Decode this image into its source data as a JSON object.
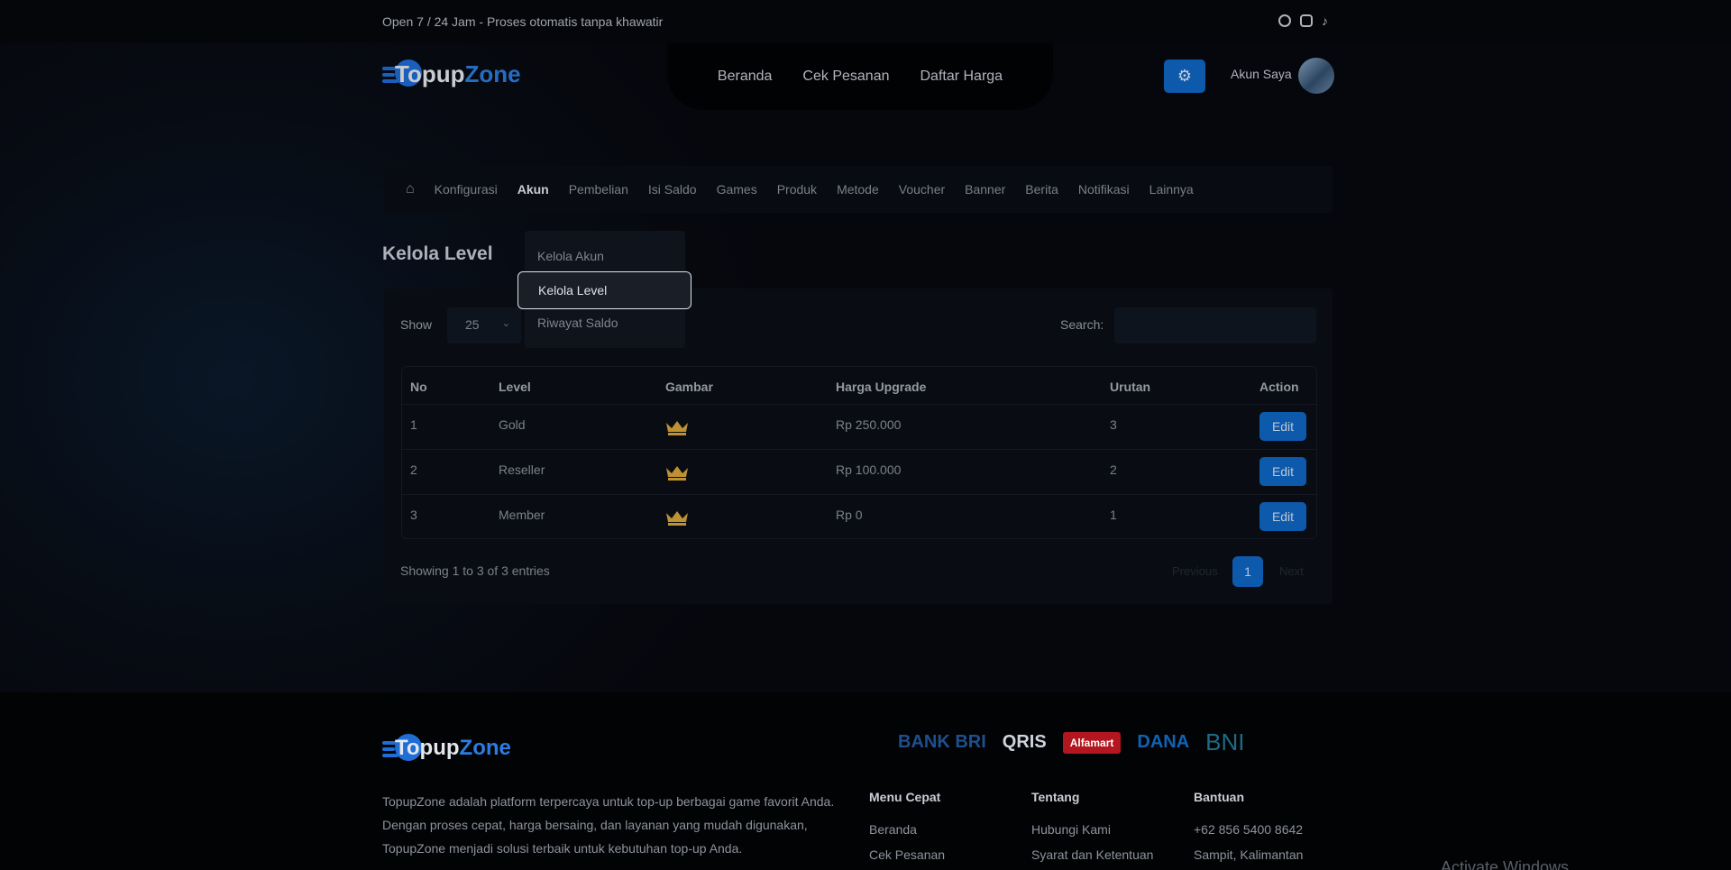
{
  "topbar": {
    "tagline": "Open 7 / 24 Jam - Proses otomatis tanpa khawatir"
  },
  "brand": {
    "part1": "Topup",
    "part2": "Zone"
  },
  "nav": [
    "Beranda",
    "Cek Pesanan",
    "Daftar Harga"
  ],
  "account": {
    "label": "Akun Saya"
  },
  "admin_nav": [
    "Konfigurasi",
    "Akun",
    "Pembelian",
    "Isi Saldo",
    "Games",
    "Produk",
    "Metode",
    "Voucher",
    "Banner",
    "Berita",
    "Notifikasi",
    "Lainnya"
  ],
  "page": {
    "title": "Kelola Level"
  },
  "dropdown": [
    "Kelola Akun",
    "Kelola Level",
    "Riwayat Saldo"
  ],
  "controls": {
    "show_label": "Show",
    "show_value": "25",
    "search_label": "Search:"
  },
  "table": {
    "headers": [
      "No",
      "Level",
      "Gambar",
      "Harga Upgrade",
      "Urutan",
      "Action"
    ],
    "rows": [
      {
        "no": "1",
        "level": "Gold",
        "price": "Rp 250.000",
        "order": "3",
        "action": "Edit"
      },
      {
        "no": "2",
        "level": "Reseller",
        "price": "Rp 100.000",
        "order": "2",
        "action": "Edit"
      },
      {
        "no": "3",
        "level": "Member",
        "price": "Rp 0",
        "order": "1",
        "action": "Edit"
      }
    ]
  },
  "pagination": {
    "info": "Showing 1 to 3 of 3 entries",
    "prev": "Previous",
    "current": "1",
    "next": "Next"
  },
  "footer": {
    "description": "TopupZone adalah platform terpercaya untuk top-up berbagai game favorit Anda. Dengan proses cepat, harga bersaing, dan layanan yang mudah digunakan, TopupZone menjadi solusi terbaik untuk kebutuhan top-up Anda.",
    "payments": [
      "BANK BRI",
      "QRIS",
      "Alfamart",
      "DANA",
      "BNI"
    ],
    "columns": [
      {
        "title": "Menu Cepat",
        "links": [
          "Beranda",
          "Cek Pesanan"
        ]
      },
      {
        "title": "Tentang",
        "links": [
          "Hubungi Kami",
          "Syarat dan Ketentuan"
        ]
      },
      {
        "title": "Bantuan",
        "links": [
          "+62 856 5400 8642",
          "Sampit, Kalimantan"
        ]
      }
    ]
  },
  "watermark": "Activate Windows",
  "colors": {
    "accent": "#0f66c4",
    "crown": "#d9a63a"
  }
}
